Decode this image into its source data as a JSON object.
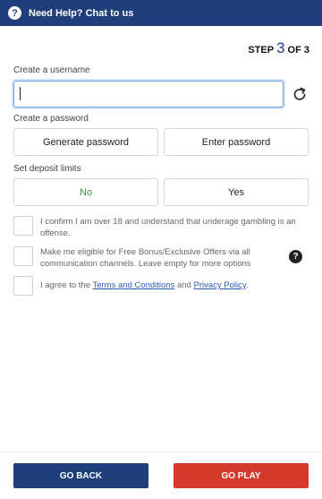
{
  "header": {
    "help_icon_glyph": "?",
    "help_text": "Need Help? Chat to us",
    "help_icon": "question-circle-icon",
    "bg_color": "#1f3f7c"
  },
  "step": {
    "prefix": "STEP",
    "current": "3",
    "suffix": "OF 3"
  },
  "username": {
    "label": "Create a username",
    "value": "",
    "refresh_icon": "refresh-icon"
  },
  "password": {
    "label": "Create a password",
    "options": [
      "Generate password",
      "Enter password"
    ]
  },
  "deposit": {
    "label": "Set deposit limits",
    "options": [
      "No",
      "Yes"
    ],
    "selected_color": "#3a9a3a"
  },
  "checks": {
    "age": "I confirm I am over 18 and understand that underage gambling is an offense.",
    "offers": "Make me eligible for Free Bonus/Exclusive Offers via all communication channels. Leave empty for more options",
    "offers_help_glyph": "?",
    "terms_prefix": "I agree to the ",
    "terms_link": "Terms and Conditions",
    "terms_mid": " and ",
    "privacy_link": "Privacy Policy",
    "terms_suffix": "."
  },
  "actions": {
    "back": "GO BACK",
    "play": "GO PLAY",
    "back_color": "#1f3f7c",
    "play_color": "#d33a2c"
  }
}
